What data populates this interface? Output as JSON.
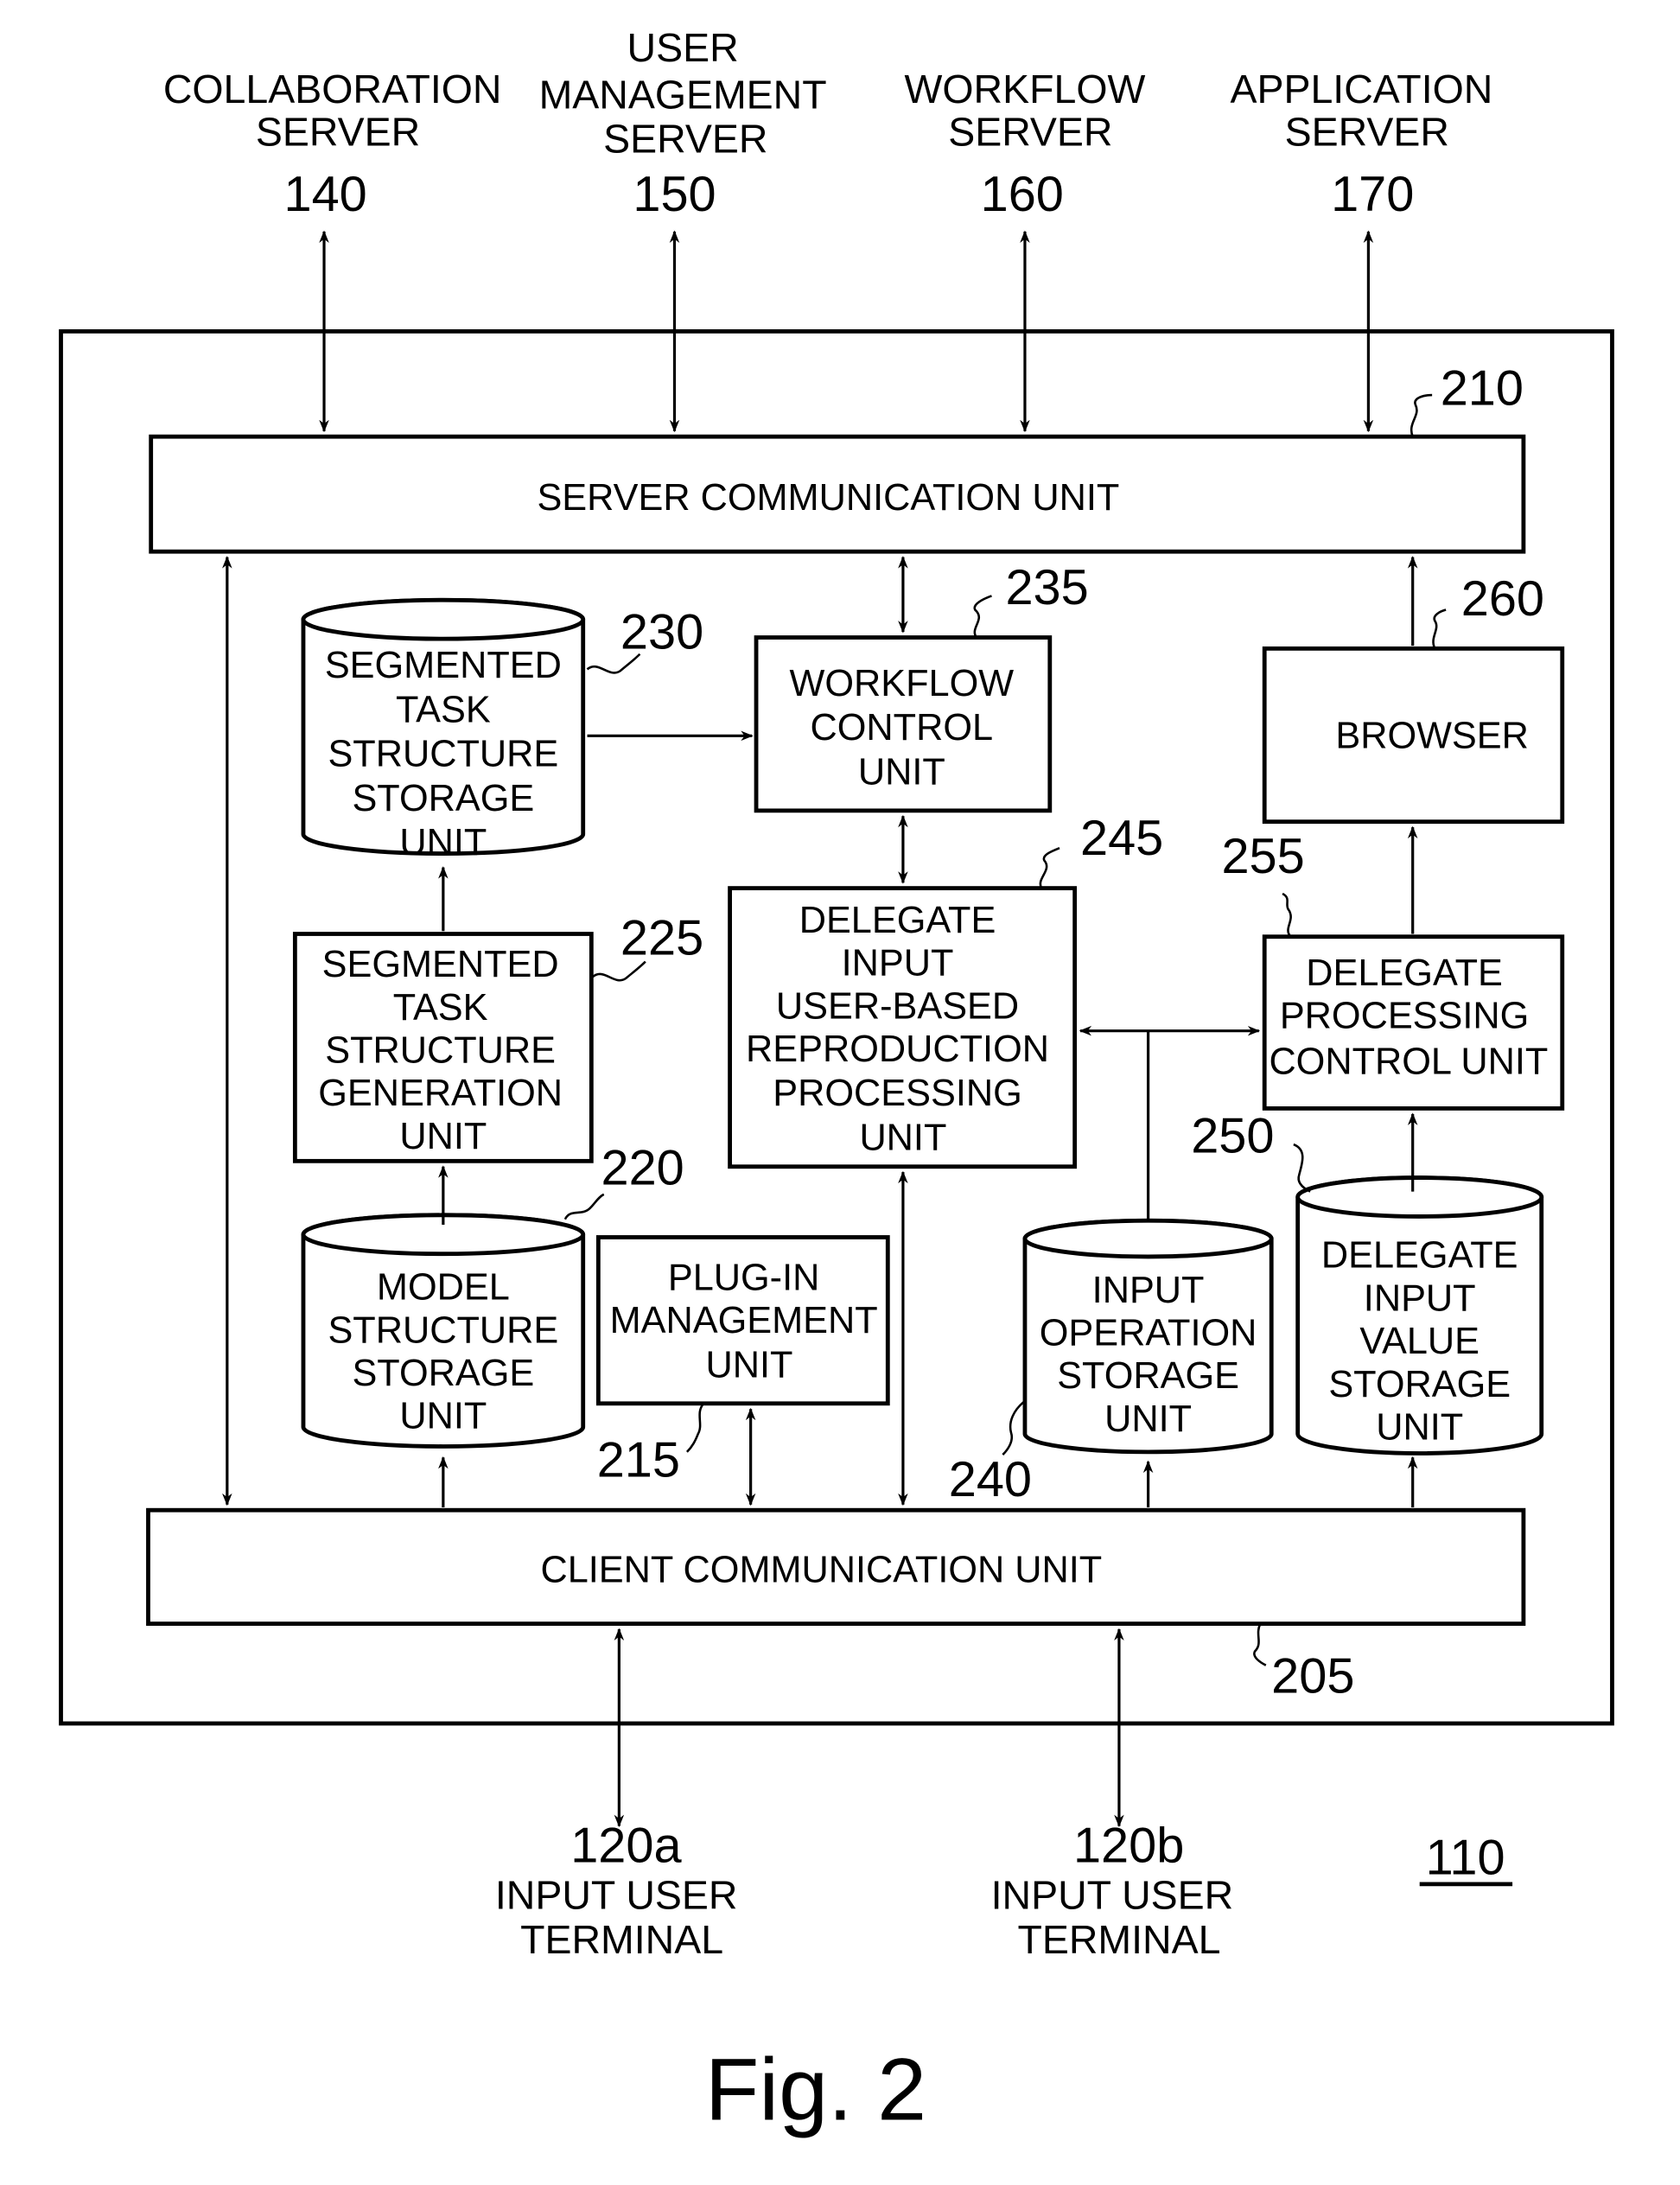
{
  "figure": {
    "caption": "Fig. 2",
    "device_ref": "110"
  },
  "external_servers": [
    {
      "name_lines": [
        "COLLABORATION",
        "SERVER"
      ],
      "ref": "140"
    },
    {
      "name_lines": [
        "USER",
        "MANAGEMENT",
        "SERVER"
      ],
      "ref": "150"
    },
    {
      "name_lines": [
        "WORKFLOW",
        "SERVER"
      ],
      "ref": "160"
    },
    {
      "name_lines": [
        "APPLICATION",
        "SERVER"
      ],
      "ref": "170"
    }
  ],
  "terminals": [
    {
      "ref": "120a",
      "name_lines": [
        "INPUT USER",
        "TERMINAL"
      ]
    },
    {
      "ref": "120b",
      "name_lines": [
        "INPUT USER",
        "TERMINAL"
      ]
    }
  ],
  "units": {
    "server_comm": {
      "label": "SERVER COMMUNICATION UNIT",
      "ref": "210"
    },
    "client_comm": {
      "label": "CLIENT COMMUNICATION UNIT",
      "ref": "205"
    },
    "plugin": {
      "lines": [
        "PLUG-IN",
        "MANAGEMENT",
        "UNIT"
      ],
      "ref": "215"
    },
    "model_storage": {
      "lines": [
        "MODEL",
        "STRUCTURE",
        "STORAGE",
        "UNIT"
      ],
      "ref": "220"
    },
    "seg_gen": {
      "lines": [
        "SEGMENTED",
        "TASK",
        "STRUCTURE",
        "GENERATION",
        "UNIT"
      ],
      "ref": "225"
    },
    "seg_storage": {
      "lines": [
        "SEGMENTED",
        "TASK",
        "STRUCTURE",
        "STORAGE",
        "UNIT"
      ],
      "ref": "230"
    },
    "workflow_ctrl": {
      "lines": [
        "WORKFLOW",
        "CONTROL",
        "UNIT"
      ],
      "ref": "235"
    },
    "input_op_storage": {
      "lines": [
        "INPUT",
        "OPERATION",
        "STORAGE",
        "UNIT"
      ],
      "ref": "240"
    },
    "reproduction": {
      "lines": [
        "DELEGATE",
        "INPUT",
        "USER-BASED",
        "REPRODUCTION",
        "PROCESSING",
        "UNIT"
      ],
      "ref": "245"
    },
    "delegate_value_storage": {
      "lines": [
        "DELEGATE",
        "INPUT",
        "VALUE",
        "STORAGE",
        "UNIT"
      ],
      "ref": "250"
    },
    "delegate_ctrl": {
      "lines": [
        "DELEGATE",
        "PROCESSING",
        "CONTROL UNIT"
      ],
      "ref": "255"
    },
    "browser": {
      "label": "BROWSER",
      "ref": "260"
    }
  }
}
